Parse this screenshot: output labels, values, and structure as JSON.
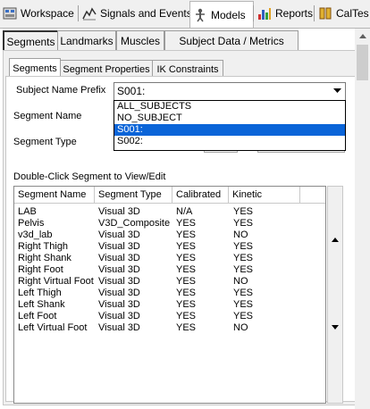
{
  "top_tabs": [
    {
      "label": "Workspace",
      "icon": "workspace-icon"
    },
    {
      "label": "Signals and Events",
      "icon": "signals-icon"
    },
    {
      "label": "Models",
      "icon": "models-icon",
      "active": true
    },
    {
      "label": "Reports",
      "icon": "reports-icon"
    },
    {
      "label": "CalTes",
      "icon": "caltest-icon"
    }
  ],
  "sub_tabs": [
    "Segments",
    "Landmarks",
    "Muscles",
    "Subject Data / Metrics"
  ],
  "inner_tabs": [
    "Segments",
    "Segment Properties",
    "IK Constraints"
  ],
  "form": {
    "subject_prefix_label": "Subject Name Prefix",
    "subject_prefix_value": "S001:",
    "segment_name_label": "Segment Name",
    "segment_type_label": "Segment Type"
  },
  "dropdown_options": [
    {
      "label": "ALL_SUBJECTS",
      "selected": false
    },
    {
      "label": "NO_SUBJECT",
      "selected": false
    },
    {
      "label": "S001:",
      "selected": true
    },
    {
      "label": "S002:",
      "selected": false
    }
  ],
  "list_title": "Double-Click Segment to View/Edit",
  "columns": [
    "Segment Name",
    "Segment Type",
    "Calibrated",
    "Kinetic"
  ],
  "rows": [
    [
      "LAB",
      "Visual 3D",
      "N/A",
      "YES"
    ],
    [
      "Pelvis",
      "V3D_Composite",
      "YES",
      "YES"
    ],
    [
      "v3d_lab",
      "Visual 3D",
      "YES",
      "NO"
    ],
    [
      "Right Thigh",
      "Visual 3D",
      "YES",
      "YES"
    ],
    [
      "Right Shank",
      "Visual 3D",
      "YES",
      "YES"
    ],
    [
      "Right Foot",
      "Visual 3D",
      "YES",
      "YES"
    ],
    [
      "Right Virtual Foot",
      "Visual 3D",
      "YES",
      "NO"
    ],
    [
      "Left Thigh",
      "Visual 3D",
      "YES",
      "YES"
    ],
    [
      "Left Shank",
      "Visual 3D",
      "YES",
      "YES"
    ],
    [
      "Left Foot",
      "Visual 3D",
      "YES",
      "YES"
    ],
    [
      "Left Virtual Foot",
      "Visual 3D",
      "YES",
      "NO"
    ]
  ],
  "colors": {
    "selection": "#0a64d8",
    "background": "#f0f0f0"
  }
}
